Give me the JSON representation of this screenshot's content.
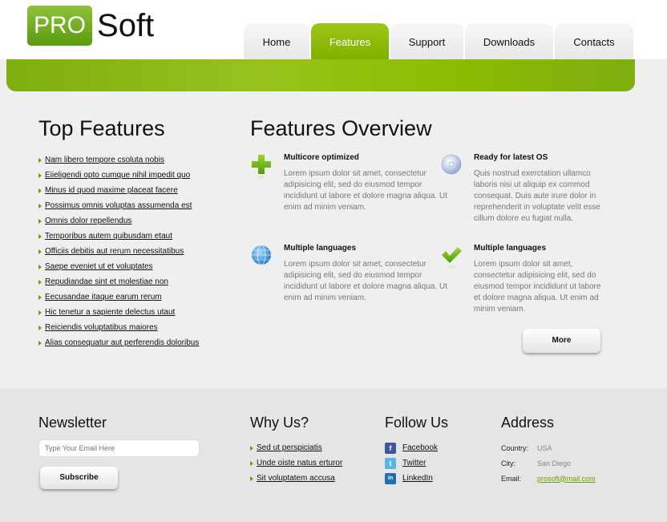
{
  "logo": {
    "pro": "PRO",
    "soft": "Soft"
  },
  "nav": {
    "tabs": [
      {
        "label": "Home",
        "active": false
      },
      {
        "label": "Features",
        "active": true
      },
      {
        "label": "Support",
        "active": false
      },
      {
        "label": "Downloads",
        "active": false
      },
      {
        "label": "Contacts",
        "active": false
      }
    ]
  },
  "colors": {
    "accent": "#8cbd00",
    "accent_dark": "#6aa100"
  },
  "top_features": {
    "title": "Top Features",
    "items": [
      "Nam libero tempore csoluta nobis",
      "Eiieligendi opto cumque nihil impedit quo",
      "Minus id quod maxime placeat facere",
      "Possimus omnis voluptas assumenda est",
      "Omnis dolor repellendus",
      "Temporibus autem quibusdam etaut",
      "Officiis debitis aut rerum necessitatibus",
      "Saepe eveniet ut et voluptates",
      "Repudiandae sint et molestiae non",
      "Eecusandae itaque earum rerum",
      "Hic tenetur a sapiente delectus utaut",
      "Reiciendis voluptatibus maiores",
      "Alias consequatur aut perferendis doloribus"
    ]
  },
  "overview": {
    "title": "Features Overview",
    "features": [
      {
        "icon": "plus-icon",
        "title": "Multicore optimized",
        "text": "Lorem ipsum dolor sit amet, consectetur adipisicing elit, sed do eiusmod tempor incididunt ut labore et dolore magna aliqua. Ut enim ad minim veniam."
      },
      {
        "icon": "disc-icon",
        "title": "Ready for latest OS",
        "text": "Quis nostrud exerctation ullamco laboris nisi ut aliquip ex commod consequat. Duis aute irure dolor in reprehenderit in voluptate velit esse cillum dolore eu fugiat nulla."
      },
      {
        "icon": "globe-icon",
        "title": "Multiple languages",
        "text": "Lorem ipsum dolor sit amet, consectetur adipisicing elit, sed do eiusmod tempor incididunt ut labore et dolore magna aliqua. Ut enim ad minim veniam."
      },
      {
        "icon": "checkmark-icon",
        "title": "Multiple languages",
        "text": "Lorem ipsum dolor sit amet, consectetur adipisicing elit, sed do eiusmod tempor incididunt ut labore et dolore magna aliqua. Ut enim ad minim veniam."
      }
    ],
    "more_label": "More"
  },
  "footer": {
    "newsletter": {
      "title": "Newsletter",
      "placeholder": "Type Your Email Here",
      "subscribe_label": "Subscribe"
    },
    "why": {
      "title": "Why Us?",
      "items": [
        "Sed ut perspiciatis",
        "Unde oiste natus erturor",
        "Sit voluptatem accusa"
      ]
    },
    "follow": {
      "title": "Follow Us",
      "items": [
        {
          "label": "Facebook",
          "icon": "facebook-icon",
          "color": "#3b5998",
          "glyph": "f"
        },
        {
          "label": "Twitter",
          "icon": "twitter-icon",
          "color": "#55b7e8",
          "glyph": "t"
        },
        {
          "label": "LinkedIn",
          "icon": "linkedin-icon",
          "color": "#1f6fae",
          "glyph": "in"
        }
      ]
    },
    "address": {
      "title": "Address",
      "rows": [
        {
          "label": "Country:",
          "value": "USA"
        },
        {
          "label": "City:",
          "value": "San Diego"
        },
        {
          "label": "Email:",
          "value": "prosoft@mail.com"
        }
      ]
    }
  }
}
